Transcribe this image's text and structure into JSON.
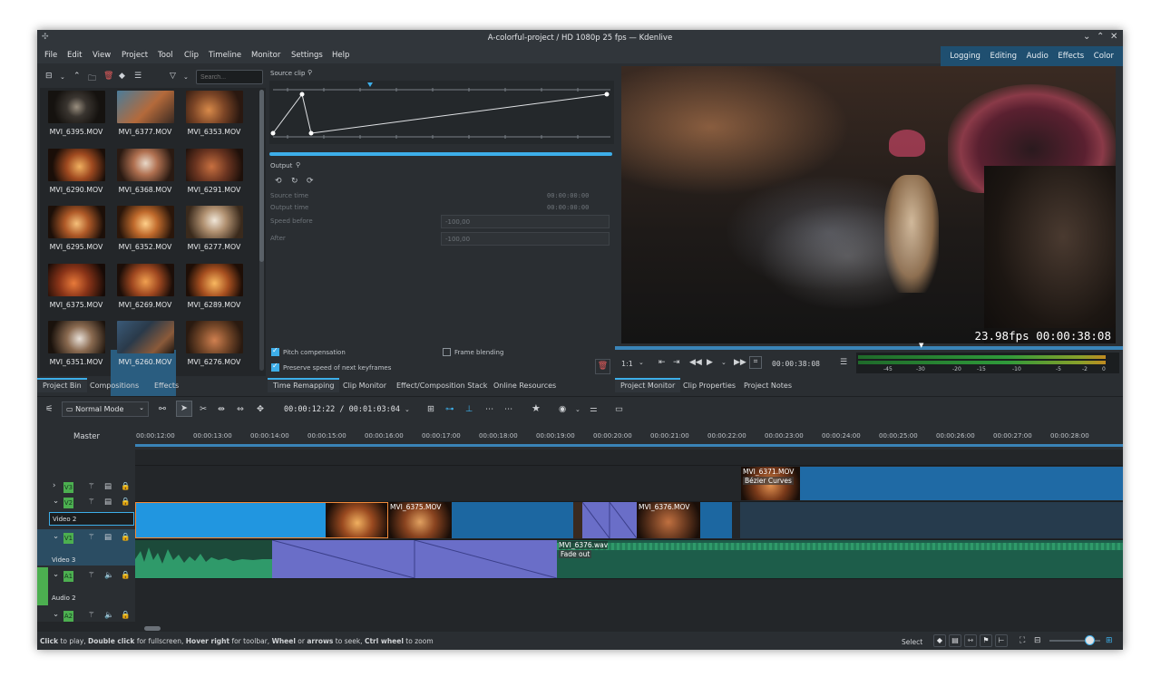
{
  "window": {
    "title": "A-colorful-project / HD 1080p 25 fps — Kdenlive"
  },
  "menu": [
    "File",
    "Edit",
    "View",
    "Project",
    "Tool",
    "Clip",
    "Timeline",
    "Monitor",
    "Settings",
    "Help"
  ],
  "workspaces": [
    "Logging",
    "Editing",
    "Audio",
    "Effects",
    "Color"
  ],
  "bin": {
    "search_placeholder": "Search...",
    "clips": [
      "MVI_6395.MOV",
      "MVI_6377.MOV",
      "MVI_6353.MOV",
      "MVI_6290.MOV",
      "MVI_6368.MOV",
      "MVI_6291.MOV",
      "MVI_6295.MOV",
      "MVI_6352.MOV",
      "MVI_6277.MOV",
      "MVI_6375.MOV",
      "MVI_6269.MOV",
      "MVI_6289.MOV",
      "MVI_6351.MOV",
      "MVI_6260.MOV",
      "MVI_6276.MOV"
    ],
    "tabs": [
      "Project Bin",
      "Compositions",
      "Effects"
    ]
  },
  "remap": {
    "source_clip": "Source clip",
    "output": "Output",
    "source_time_label": "Source time",
    "source_time": "00:00:00:00",
    "output_time_label": "Output time",
    "output_time": "00:00:00:00",
    "speed_before_label": "Speed before",
    "speed_before": "-100,00",
    "after_label": "After",
    "after": "-100,00",
    "pitch_comp": "Pitch compensation",
    "frame_blending": "Frame blending",
    "preserve_speed": "Preserve speed of next keyframes",
    "tabs": [
      "Time Remapping",
      "Clip Monitor",
      "Effect/Composition Stack",
      "Online Resources"
    ]
  },
  "monitor": {
    "fps": "23.98fps",
    "timecode": "00:00:38:08",
    "zoom": "1:1",
    "position": "00:00:38:08",
    "meter_labels": [
      "-45",
      "-30",
      "-20",
      "-15",
      "-10",
      "-5",
      "-2",
      "0"
    ],
    "tabs": [
      "Project Monitor",
      "Clip Properties",
      "Project Notes"
    ]
  },
  "toolbar": {
    "mode": "Normal Mode",
    "timecode": "00:00:12:22 / 00:01:03:04"
  },
  "timeline": {
    "master": "Master",
    "ruler": [
      "00:00:12:00",
      "00:00:13:00",
      "00:00:14:00",
      "00:00:15:00",
      "00:00:16:00",
      "00:00:17:00",
      "00:00:18:00",
      "00:00:19:00",
      "00:00:20:00",
      "00:00:21:00",
      "00:00:22:00",
      "00:00:23:00",
      "00:00:24:00",
      "00:00:25:00",
      "00:00:26:00",
      "00:00:27:00",
      "00:00:28:00"
    ],
    "tracks": {
      "v3": "V3",
      "v2": "V2",
      "v1": "V1",
      "a1": "A1",
      "a2": "A2"
    },
    "track_names": {
      "video2": "Video 2",
      "video3": "Video 3",
      "audio2": "Audio 2"
    },
    "clip_6371": "MVI_6371.MOV",
    "effect_bezier": "Bézier Curves",
    "clip_6375": "MVI_6375.MOV",
    "clip_6376": "MVI_6376.MOV",
    "audio_clip": "MVI_6376.wav",
    "fade_out": "Fade out"
  },
  "status": {
    "b1": "Click",
    "t1": " to play, ",
    "b2": "Double click",
    "t2": " for fullscreen, ",
    "b3": "Hover right",
    "t3": " for toolbar, ",
    "b4": "Wheel",
    "t4": " or ",
    "b5": "arrows",
    "t5": " to seek, ",
    "b6": "Ctrl wheel",
    "t6": " to zoom",
    "select": "Select"
  }
}
